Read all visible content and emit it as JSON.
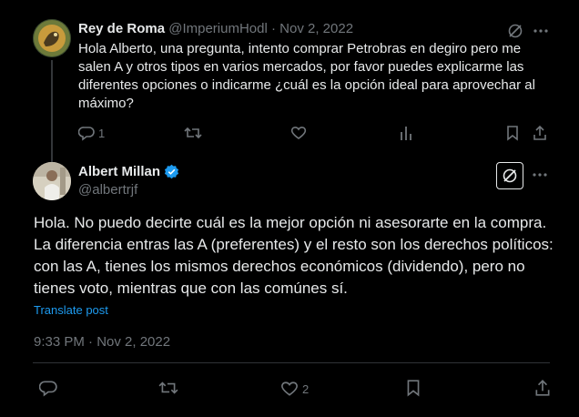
{
  "parent_tweet": {
    "author_name": "Rey de Roma",
    "author_handle": "@ImperiumHodl",
    "separator": "·",
    "date": "Nov 2, 2022",
    "text": "Hola Alberto, una pregunta, intento comprar Petrobras en degiro pero me salen A y otros tipos en varios mercados, por favor puedes explicarme las diferentes opciones o indicarme ¿cuál es la opción ideal para aprovechar al máximo?",
    "reply_count": "1",
    "icons": [
      "grok-icon",
      "more-icon",
      "reply-icon",
      "retweet-icon",
      "like-icon",
      "views-icon",
      "bookmark-icon",
      "share-icon"
    ]
  },
  "main_tweet": {
    "author_name": "Albert Millan",
    "author_handle": "@albertrjf",
    "verified": true,
    "text": "Hola. No puedo decirte cuál es la mejor opción ni asesorarte en la compra. La diferencia entras las A (preferentes) y el resto son los derechos políticos: con las A, tienes los mismos derechos económicos (dividendo), pero no tienes voto, mientras que con las comúnes sí.",
    "translate_label": "Translate post",
    "timestamp": "9:33 PM · Nov 2, 2022",
    "like_count": "2",
    "icons": [
      "grok-icon",
      "more-icon",
      "reply-icon",
      "retweet-icon",
      "like-icon",
      "bookmark-icon",
      "share-icon"
    ]
  },
  "colors": {
    "background": "#000000",
    "text": "#e7e9ea",
    "muted": "#71767b",
    "link": "#1d9bf0",
    "verified": "#1d9bf0",
    "divider": "#2f3336"
  }
}
